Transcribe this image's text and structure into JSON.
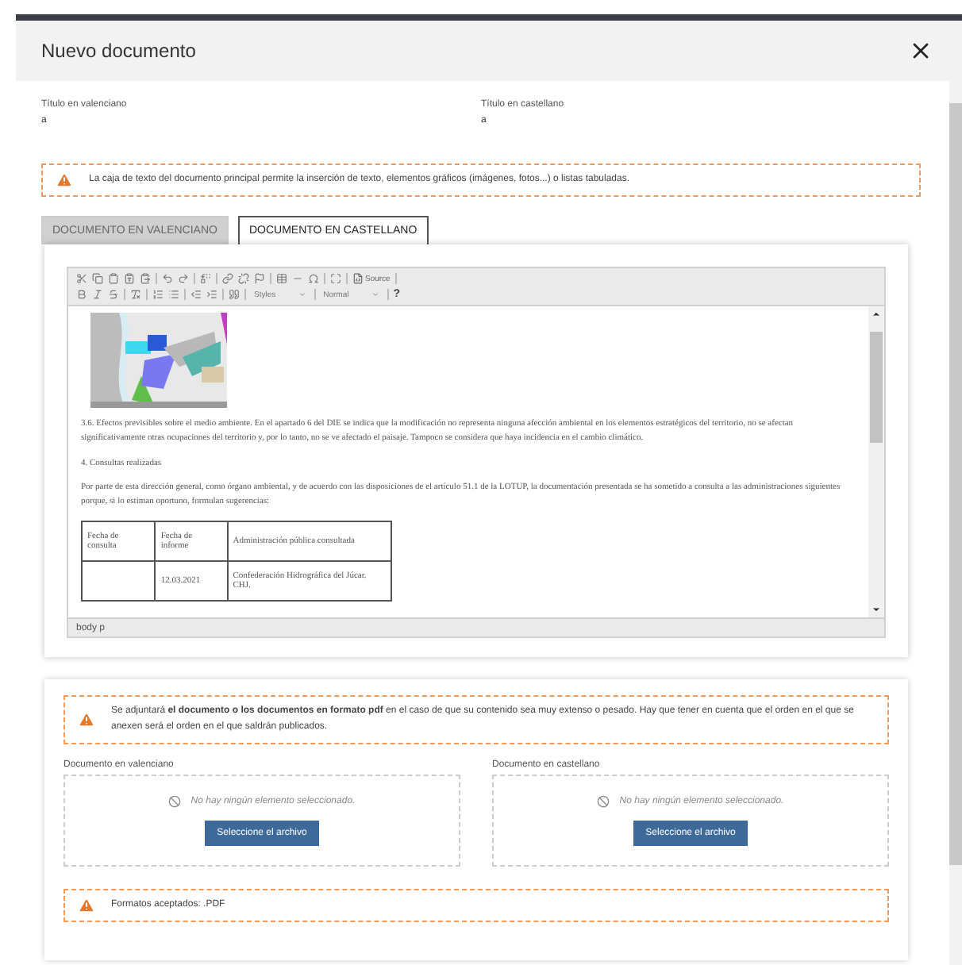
{
  "dialog": {
    "title": "Nuevo documento"
  },
  "fields": [
    {
      "label": "Título en valenciano",
      "value": "a"
    },
    {
      "label": "Título en castellano",
      "value": "a"
    }
  ],
  "notice": "La caja de texto del documento principal permite la inserción de texto, elementos gráficos (imágenes, fotos...) o listas tabuladas.",
  "tabs": [
    {
      "label": "DOCUMENTO EN VALENCIANO",
      "selected": false
    },
    {
      "label": "DOCUMENTO EN CASTELLANO",
      "selected": true
    }
  ],
  "editor": {
    "toolbar": {
      "source": "Source",
      "styles": "Styles",
      "format": "Normal",
      "help": "?"
    },
    "blocks": [
      {
        "kind": "picture"
      },
      {
        "kind": "text",
        "text": "3.6. Efectos previsibles sobre el medio ambiente. En el apartado 6 del DIE se indica que la modificación no representa ninguna afección ambiental en los elementos estratégicos del territorio, no se afectan significativamente otras ocupaciones del territorio y, por lo tanto, no se ve afectado el paisaje. Tampoco se considera que haya incidencia en el cambio climático."
      },
      {
        "kind": "text",
        "text": "4. Consultas realizadas"
      },
      {
        "kind": "text",
        "text": "Por parte de esta dirección general, como órgano ambiental, y de acuerdo con las disposiciones de el artículo 51.1 de la LOTUP, la documentación presentada se ha sometido a consulta a las administraciones siguientes porque, si lo estiman oportuno, formulan sugerencias:"
      },
      {
        "kind": "table",
        "rows": [
          [
            "Fecha de consulta",
            "Fecha de informe",
            "Administración pública consultada"
          ],
          [
            "",
            "12.03.2021",
            "Confederación Hidrográfica del Júcar. CHJ."
          ]
        ]
      }
    ],
    "status": "body p"
  },
  "attach_notice": "Se adjuntará **el documento o los documentos en formato pdf** en el caso de que su contenido sea muy extenso o pesado. Hay que tener en cuenta que el orden en el que se anexen será el orden en el que saldrán publicados.",
  "uploads": [
    {
      "label": "Documento en valenciano",
      "empty": "No hay ningún elemento seleccionado.",
      "button": "Seleccione el archivo"
    },
    {
      "label": "Documento en castellano",
      "empty": "No hay ningún elemento seleccionado.",
      "button": "Seleccione el archivo"
    }
  ],
  "formats_notice": "Formatos aceptados: .PDF"
}
